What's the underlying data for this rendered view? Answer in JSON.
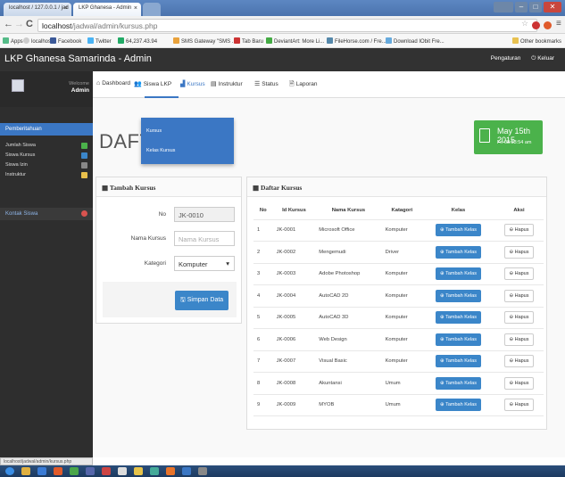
{
  "browser": {
    "tabs": [
      {
        "label": "localhost / 127.0.0.1 / jad"
      },
      {
        "label": "LKP Ghanesa - Admin"
      }
    ],
    "url_host": "localhost",
    "url_path": "/jadwal/admin/kursus.php",
    "bookmarks": [
      "Apps",
      "localhost",
      "Facebook",
      "Twitter",
      "64,237.43.94",
      "SMS Gateway \"SMS ...",
      "Tab Baru",
      "DeviantArt: More Li...",
      "FileHorse.com / Fre...",
      "Download IObit Fre..."
    ],
    "other_bookmarks": "Other bookmarks",
    "status_url": "localhost/jadwal/admin/kursus.php"
  },
  "header": {
    "brand": "LKP Ghanesa Samarinda - Admin",
    "pengaturan": "Pengaturan",
    "keluar": "Keluar"
  },
  "sidebar": {
    "welcome": "Welcome",
    "user": "Admin",
    "pemberitahuan": "Pemberitahuan",
    "items": [
      "Jumlah Siswa",
      "Siswa Kursus",
      "Siswa Izin",
      "Instruktur"
    ],
    "kontak": "Kontak Siswa"
  },
  "topnav": [
    "Dashboard",
    "Siswa LKP",
    "Kursus",
    "Instruktur",
    "Status",
    "Laporan"
  ],
  "dropdown": [
    "Kursus",
    "Kelas Kursus"
  ],
  "page_title": "DAFTAR KURSUS",
  "date": {
    "day": "May 15th 2015",
    "time": "Fri 08:53:54 am"
  },
  "form": {
    "title": "Tambah Kursus",
    "no_label": "No",
    "no_value": "JK-0010",
    "nama_label": "Nama Kursus",
    "nama_placeholder": "Nama Kursus",
    "kategori_label": "Kategori",
    "kategori_value": "Komputer",
    "submit": "Simpan Data"
  },
  "table": {
    "title": "Daftar Kursus",
    "headers": [
      "No",
      "Id Kursus",
      "Nama Kursus",
      "Katagori",
      "Kelas",
      "Aksi"
    ],
    "btn_tambah": "Tambah Kelas",
    "btn_hapus": "Hapus",
    "rows": [
      [
        "1",
        "JK-0001",
        "Microsoft Office",
        "Komputer"
      ],
      [
        "2",
        "JK-0002",
        "Mengemudi",
        "Driver"
      ],
      [
        "3",
        "JK-0003",
        "Adobe Photoshop",
        "Komputer"
      ],
      [
        "4",
        "JK-0004",
        "AutoCAD 2D",
        "Komputer"
      ],
      [
        "5",
        "JK-0005",
        "AutoCAD 3D",
        "Komputer"
      ],
      [
        "6",
        "JK-0006",
        "Web Design",
        "Komputer"
      ],
      [
        "7",
        "JK-0007",
        "Visual Basic",
        "Komputer"
      ],
      [
        "8",
        "JK-0008",
        "Akuntansi",
        "Umum"
      ],
      [
        "9",
        "JK-0009",
        "MYOB",
        "Umum"
      ]
    ]
  },
  "colors": {
    "primary": "#3b77c4",
    "header": "#323232",
    "sidebar": "#2e2e2e",
    "success": "#4bb24b"
  }
}
